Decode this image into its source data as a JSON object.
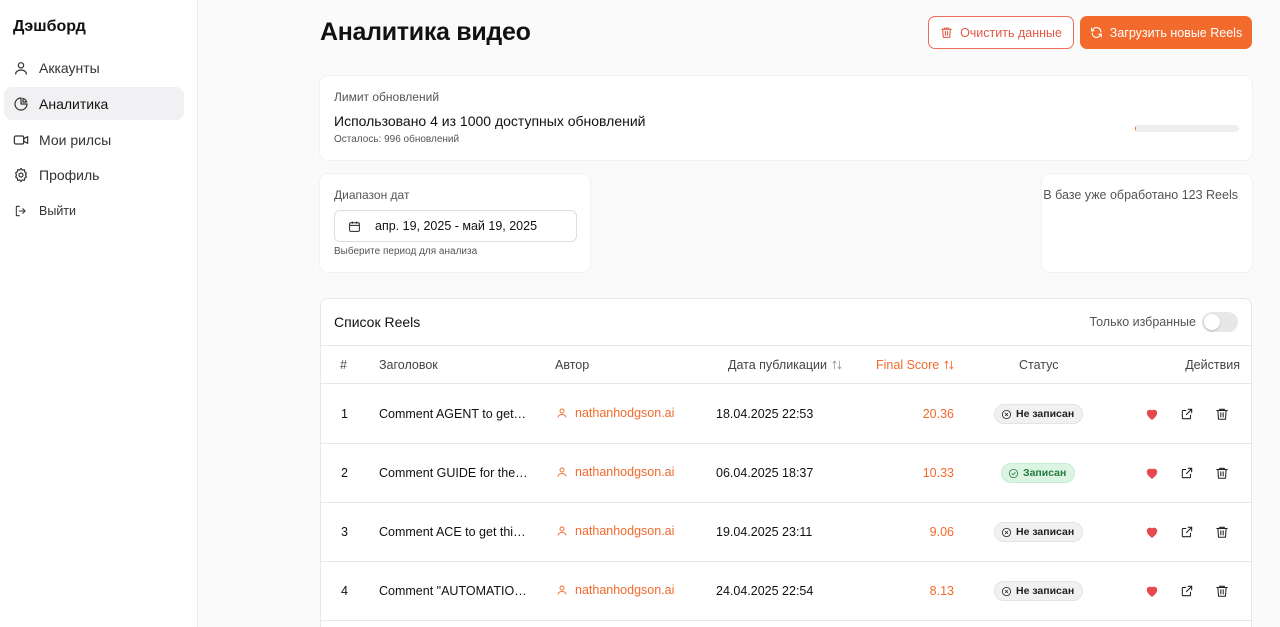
{
  "sidebar": {
    "brand": "Дэшборд",
    "items": [
      {
        "label": "Аккаунты",
        "icon": "user-icon"
      },
      {
        "label": "Аналитика",
        "icon": "pie-chart-icon",
        "active": true
      },
      {
        "label": "Мои рилсы",
        "icon": "video-icon"
      },
      {
        "label": "Профиль",
        "icon": "gear-icon"
      }
    ],
    "logout": "Выйти"
  },
  "header": {
    "title": "Аналитика видео",
    "clear_button": "Очистить данные",
    "load_button": "Загрузить новые Reels"
  },
  "limit": {
    "label": "Лимит обновлений",
    "main": "Использовано 4 из 1000 доступных обновлений",
    "remaining": "Осталось: 996 обновлений",
    "progress_fraction": 0.004
  },
  "date_range": {
    "label": "Диапазон дат",
    "value": "апр. 19, 2025 - май 19, 2025",
    "hint": "Выберите период для анализа"
  },
  "db_info": {
    "text": "В базе уже обработано 123 Reels"
  },
  "table": {
    "title": "Список Reels",
    "favorites_toggle_label": "Только избранные",
    "favorites_only": false,
    "columns": {
      "num": "#",
      "title": "Заголовок",
      "author": "Автор",
      "date": "Дата публикации",
      "score": "Final Score",
      "status": "Статус",
      "actions": "Действия"
    },
    "rows": [
      {
        "num": "1",
        "title": "Comment AGENT to get a...",
        "author": "nathanhodgson.ai",
        "date": "18.04.2025 22:53",
        "score": "20.36",
        "status": "Не записан",
        "recorded": false
      },
      {
        "num": "2",
        "title": "Comment GUIDE for the f...",
        "author": "nathanhodgson.ai",
        "date": "06.04.2025 18:37",
        "score": "10.33",
        "status": "Записан",
        "recorded": true
      },
      {
        "num": "3",
        "title": "Comment ACE to get this ...",
        "author": "nathanhodgson.ai",
        "date": "19.04.2025 23:11",
        "score": "9.06",
        "status": "Не записан",
        "recorded": false
      },
      {
        "num": "4",
        "title": "Comment \"AUTOMATION...",
        "author": "nathanhodgson.ai",
        "date": "24.04.2025 22:54",
        "score": "8.13",
        "status": "Не записан",
        "recorded": false
      }
    ]
  },
  "colors": {
    "accent": "#f26a2c",
    "danger": "#e05a48",
    "favorite": "#e5484d",
    "recorded_bg": "#dcf5e3"
  }
}
